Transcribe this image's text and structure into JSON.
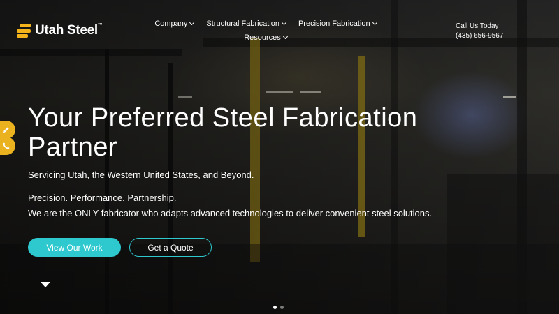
{
  "brand": {
    "name": "Utah Steel",
    "trademark": "™"
  },
  "nav": {
    "items": [
      {
        "label": "Company"
      },
      {
        "label": "Structural Fabrication"
      },
      {
        "label": "Precision Fabrication"
      },
      {
        "label": "Resources"
      }
    ]
  },
  "contact": {
    "label": "Call Us Today",
    "phone": "(435) 656-9567"
  },
  "side_tabs": [
    {
      "icon": "pencil-icon"
    },
    {
      "icon": "phone-icon"
    }
  ],
  "hero": {
    "title": "Your Preferred Steel Fabrication Partner",
    "subtitle": "Servicing Utah, the Western United States, and Beyond.",
    "tagline": "Precision. Performance. Partnership.",
    "description": "We are the ONLY fabricator who adapts advanced technologies to deliver convenient steel solutions.",
    "primary_button": "View Our Work",
    "secondary_button": "Get a Quote"
  },
  "slider": {
    "total": 2,
    "active": 1
  },
  "colors": {
    "accent": "#2ec9cf",
    "brand_yellow": "#f3b31b",
    "tab_yellow": "#e9b21e"
  }
}
